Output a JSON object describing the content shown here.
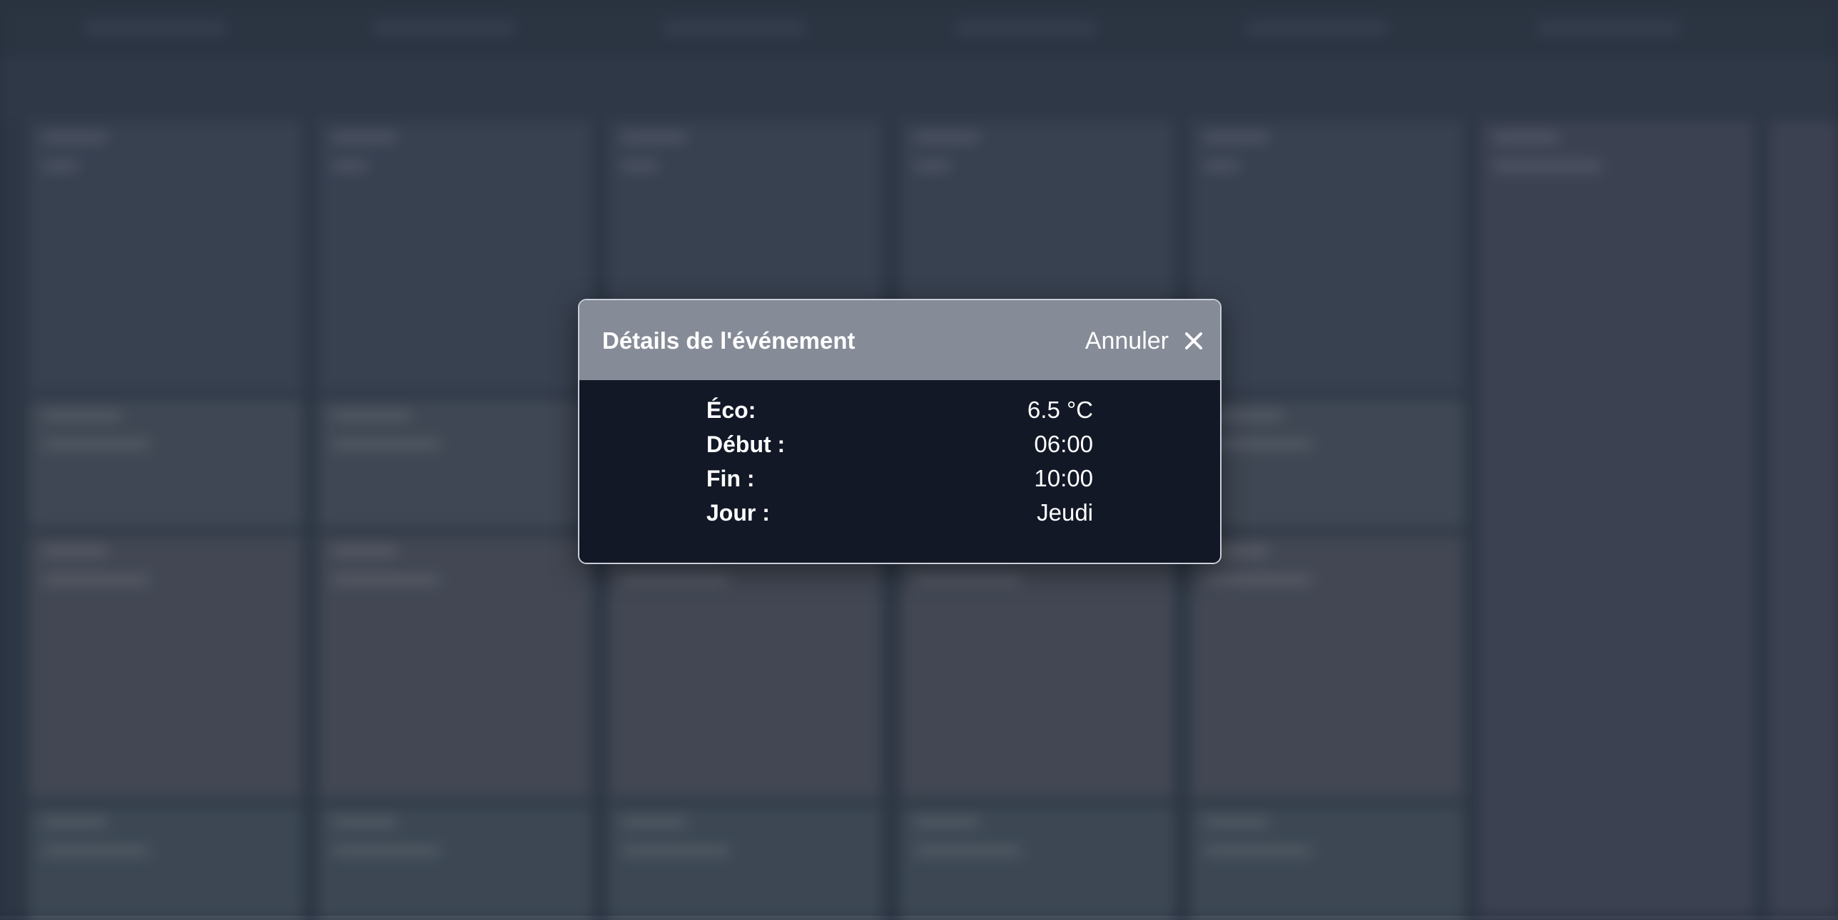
{
  "modal": {
    "title": "Détails de l'événement",
    "cancel_label": "Annuler",
    "close_icon": "close-icon",
    "details": [
      {
        "label": "Éco:",
        "value": "6.5 °C"
      },
      {
        "label": "Début :",
        "value": "06:00"
      },
      {
        "label": "Fin :",
        "value": "10:00"
      },
      {
        "label": "Jour :",
        "value": "Jeudi"
      }
    ]
  },
  "colors": {
    "header_bg": "#868b98",
    "body_bg": "#121826",
    "border": "#c9ced8",
    "text": "#ffffff"
  }
}
